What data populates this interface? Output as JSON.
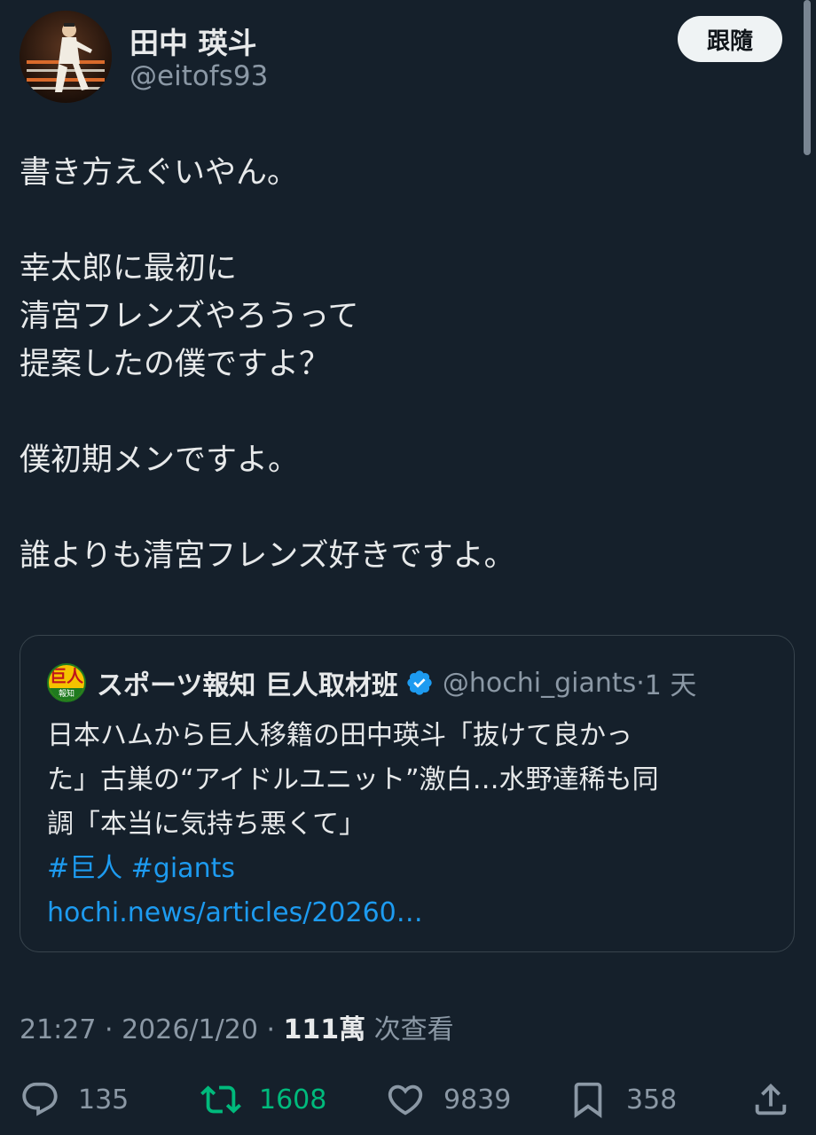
{
  "author": {
    "display_name": "田中 瑛斗",
    "handle": "@eitofs93",
    "follow_label": "跟隨"
  },
  "tweet": {
    "lines": [
      "書き方えぐいやん。",
      "",
      "幸太郎に最初に",
      "清宮フレンズやろうって",
      "提案したの僕ですよ？",
      "",
      "僕初期メンですよ。",
      "",
      "誰よりも清宮フレンズ好きですよ。"
    ]
  },
  "quote": {
    "logo_text": "巨人",
    "logo_band": "報知",
    "name": "スポーツ報知 巨人取材班",
    "handle": "@hochi_giants",
    "dot": "·",
    "time": "1 天",
    "body_lines": [
      "日本ハムから巨人移籍の田中瑛斗「抜けて良かっ",
      "た」古巣の“アイドルユニット”激白…水野達稀も同",
      "調「本当に気持ち悪くて」"
    ],
    "hashtags": "#巨人 #giants",
    "link": "hochi.news/articles/20260…"
  },
  "meta": {
    "time": "21:27",
    "sep1": " · ",
    "date": "2026/1/20",
    "sep2": " · ",
    "views_count": "111萬",
    "views_label": " 次查看"
  },
  "actions": {
    "reply_count": "135",
    "retweet_count": "1608",
    "like_count": "9839",
    "bookmark_count": "358"
  },
  "colors": {
    "background": "#15202b",
    "text": "#e7e9ea",
    "secondary": "#8b98a5",
    "link": "#1d9bf0",
    "retweet": "#00ba7c",
    "border": "#38444d"
  },
  "icons": {
    "reply": "speech-bubble-icon",
    "retweet": "retweet-arrows-icon",
    "like": "heart-icon",
    "bookmark": "bookmark-icon",
    "share": "share-upload-icon",
    "verified": "verified-badge-icon"
  }
}
